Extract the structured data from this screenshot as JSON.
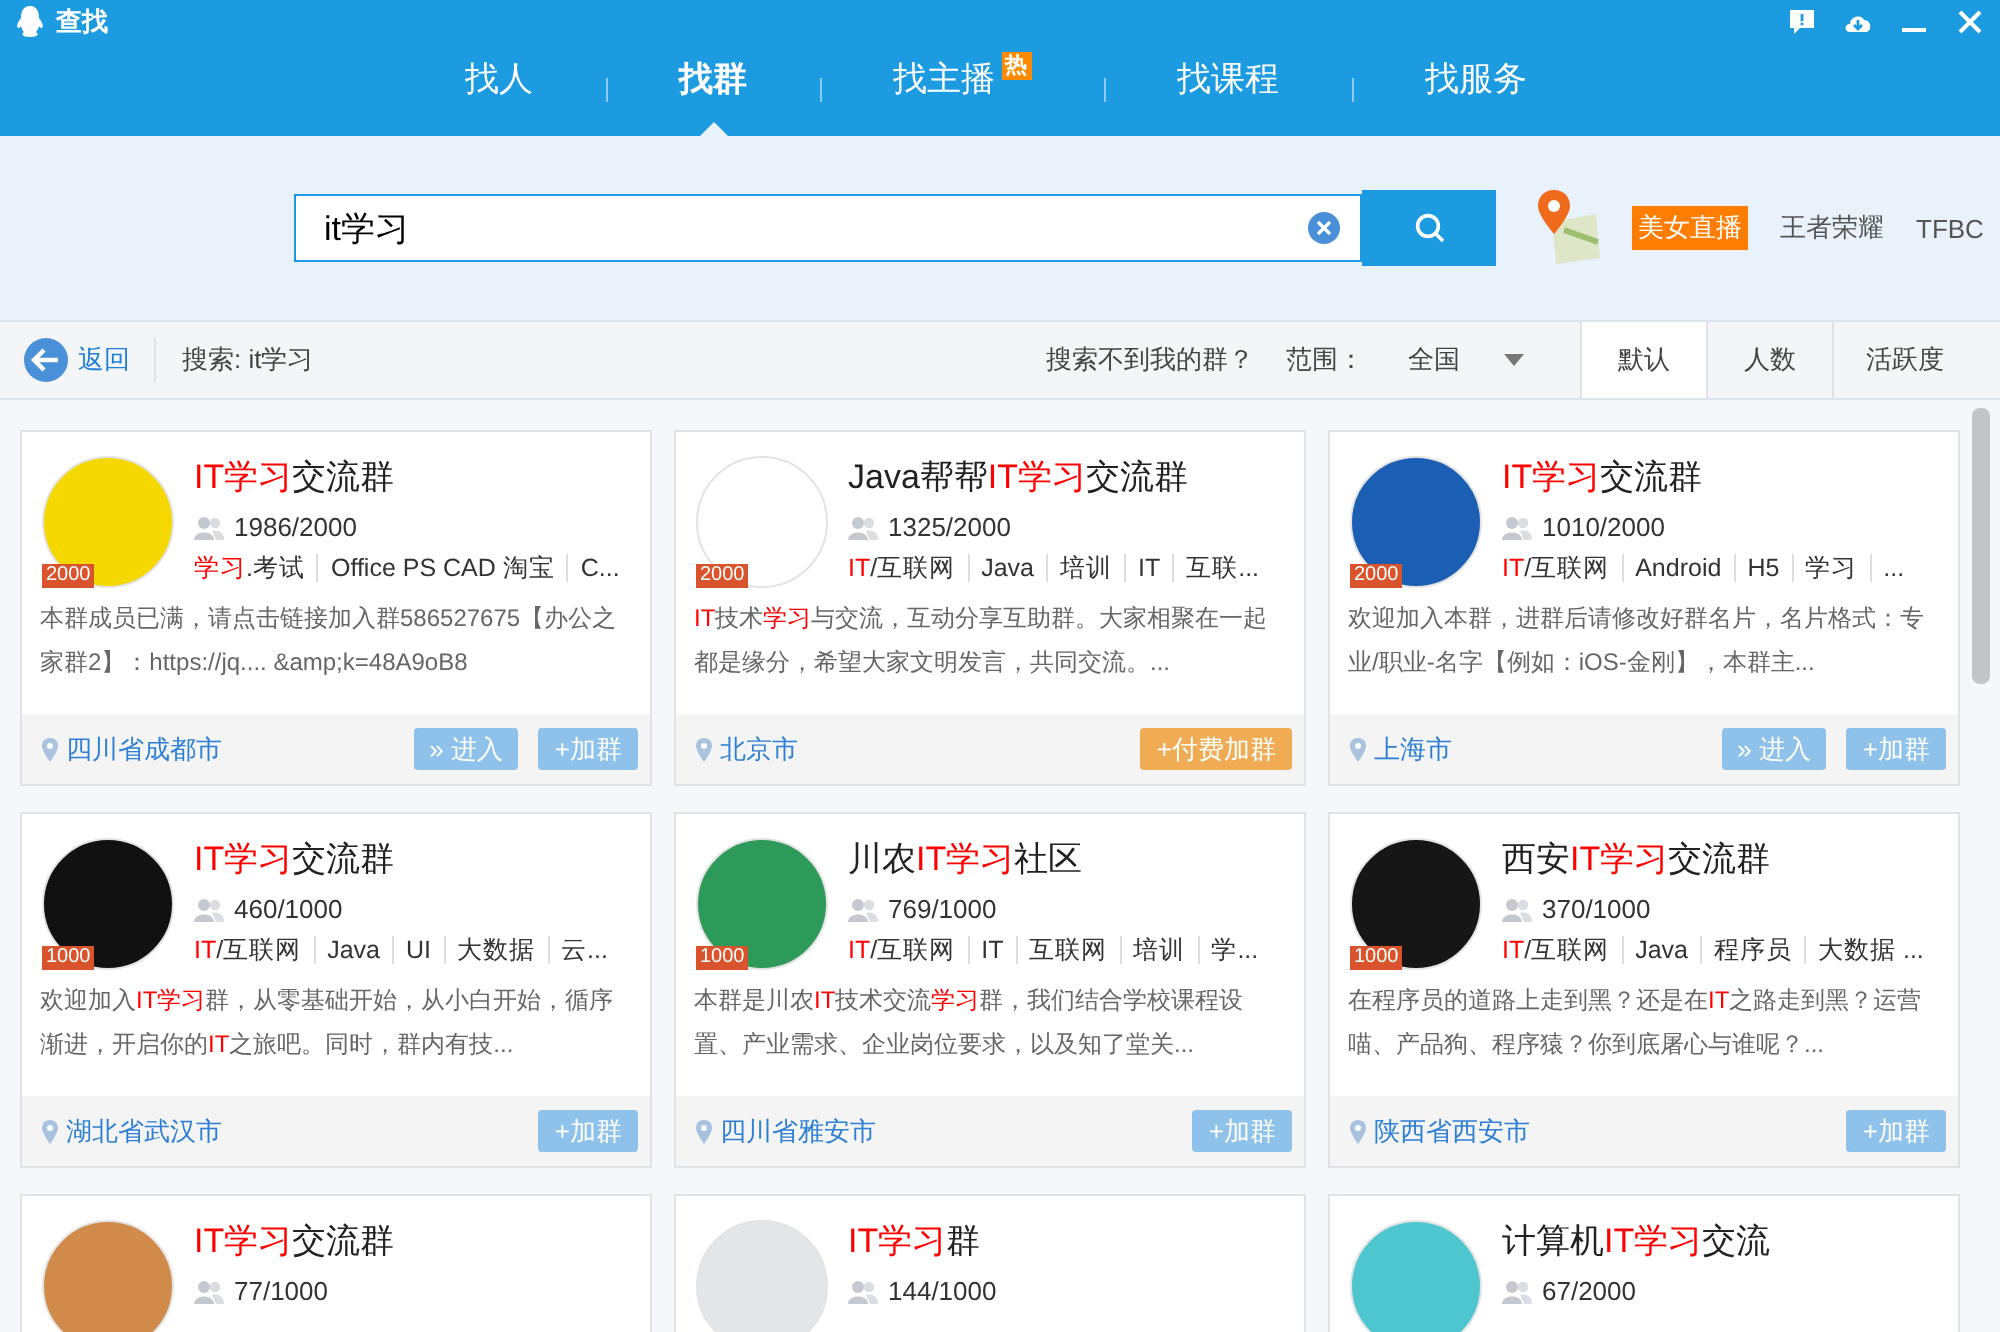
{
  "window": {
    "title": "查找"
  },
  "tabs": [
    {
      "label": "找人",
      "selected": false
    },
    {
      "label": "找群",
      "selected": true
    },
    {
      "label": "找主播",
      "selected": false,
      "badge": "热"
    },
    {
      "label": "找课程",
      "selected": false
    },
    {
      "label": "找服务",
      "selected": false
    }
  ],
  "search": {
    "value": "it学习"
  },
  "hot_links": [
    {
      "label": "美女直播",
      "kind": "tag"
    },
    {
      "label": "王者荣耀",
      "kind": "plain"
    },
    {
      "label": "TFBC",
      "kind": "plain"
    }
  ],
  "toolbar": {
    "back": "返回",
    "query": "搜索: it学习",
    "help": "搜索不到我的群？",
    "range_label": "范围：",
    "range_value": "全国",
    "sort_tabs": [
      {
        "label": "默认",
        "selected": true
      },
      {
        "label": "人数",
        "selected": false
      },
      {
        "label": "活跃度",
        "selected": false
      }
    ]
  },
  "groups": [
    {
      "color": "#f5d800",
      "cap": "2000",
      "title": [
        {
          "text": "IT学习",
          "match": true
        },
        {
          "text": "交流群",
          "match": false
        }
      ],
      "count": "1986/2000",
      "tags": [
        [
          {
            "text": "学习",
            "match": true
          },
          {
            "text": ".考试",
            "match": false
          }
        ],
        [
          {
            "text": "Office PS CAD 淘宝",
            "match": false
          }
        ],
        [
          {
            "text": "C...",
            "match": false
          }
        ]
      ],
      "desc": [
        {
          "text": "本群成员已满，请点击链接加入群586527675【办公之家群2】：https://jq.... &amp;k=48A9oB8",
          "match": false
        }
      ],
      "location": "四川省成都市",
      "buttons": [
        {
          "kind": "enter",
          "label": "» 进入"
        },
        {
          "kind": "join",
          "label": "+加群"
        }
      ]
    },
    {
      "color": "#ffffff",
      "cap": "2000",
      "title": [
        {
          "text": "Java帮帮",
          "match": false
        },
        {
          "text": "IT学习",
          "match": true
        },
        {
          "text": "交流群",
          "match": false
        }
      ],
      "count": "1325/2000",
      "tags": [
        [
          {
            "text": "IT",
            "match": true
          },
          {
            "text": "/互联网",
            "match": false
          }
        ],
        [
          {
            "text": "Java",
            "match": false
          }
        ],
        [
          {
            "text": "培训",
            "match": false
          }
        ],
        [
          {
            "text": "IT",
            "match": false
          }
        ],
        [
          {
            "text": "互联...",
            "match": false
          }
        ]
      ],
      "desc": [
        {
          "text": "IT",
          "match": true
        },
        {
          "text": "技术",
          "match": false
        },
        {
          "text": "学习",
          "match": true
        },
        {
          "text": "与交流，互动分享互助群。大家相聚在一起都是缘分，希望大家文明发言，共同交流。...",
          "match": false
        }
      ],
      "location": "北京市",
      "buttons": [
        {
          "kind": "paid_join",
          "label": "+付费加群"
        }
      ]
    },
    {
      "color": "#1a5fb4",
      "cap": "2000",
      "title": [
        {
          "text": "IT学习",
          "match": true
        },
        {
          "text": "交流群",
          "match": false
        }
      ],
      "count": "1010/2000",
      "tags": [
        [
          {
            "text": "IT",
            "match": true
          },
          {
            "text": "/互联网",
            "match": false
          }
        ],
        [
          {
            "text": "Android",
            "match": false
          }
        ],
        [
          {
            "text": "H5",
            "match": false
          }
        ],
        [
          {
            "text": "学习",
            "match": false
          }
        ],
        [
          {
            "text": "...",
            "match": false
          }
        ]
      ],
      "desc": [
        {
          "text": "欢迎加入本群，进群后请修改好群名片，名片格式：专业/职业-名字【例如：iOS-金刚】，本群主...",
          "match": false
        }
      ],
      "location": "上海市",
      "buttons": [
        {
          "kind": "enter",
          "label": "» 进入"
        },
        {
          "kind": "join",
          "label": "+加群"
        }
      ]
    },
    {
      "color": "#111111",
      "cap": "1000",
      "title": [
        {
          "text": "IT学习",
          "match": true
        },
        {
          "text": "交流群",
          "match": false
        }
      ],
      "count": "460/1000",
      "tags": [
        [
          {
            "text": "IT",
            "match": true
          },
          {
            "text": "/互联网",
            "match": false
          }
        ],
        [
          {
            "text": "Java",
            "match": false
          }
        ],
        [
          {
            "text": "UI",
            "match": false
          }
        ],
        [
          {
            "text": "大数据",
            "match": false
          }
        ],
        [
          {
            "text": "云...",
            "match": false
          }
        ]
      ],
      "desc": [
        {
          "text": "欢迎加入",
          "match": false
        },
        {
          "text": "IT学习",
          "match": true
        },
        {
          "text": "群，从零基础开始，从小白开始，循序渐进，开启你的",
          "match": false
        },
        {
          "text": "IT",
          "match": true
        },
        {
          "text": "之旅吧。同时，群内有技...",
          "match": false
        }
      ],
      "location": "湖北省武汉市",
      "buttons": [
        {
          "kind": "join",
          "label": "+加群"
        }
      ]
    },
    {
      "color": "#2e9a5a",
      "cap": "1000",
      "title": [
        {
          "text": "川农",
          "match": false
        },
        {
          "text": "IT学习",
          "match": true
        },
        {
          "text": "社区",
          "match": false
        }
      ],
      "count": "769/1000",
      "tags": [
        [
          {
            "text": "IT",
            "match": true
          },
          {
            "text": "/互联网",
            "match": false
          }
        ],
        [
          {
            "text": "IT",
            "match": false
          }
        ],
        [
          {
            "text": "互联网",
            "match": false
          }
        ],
        [
          {
            "text": "培训",
            "match": false
          }
        ],
        [
          {
            "text": "学...",
            "match": false
          }
        ]
      ],
      "desc": [
        {
          "text": "本群是川农",
          "match": false
        },
        {
          "text": "IT",
          "match": true
        },
        {
          "text": "技术交流",
          "match": false
        },
        {
          "text": "学习",
          "match": true
        },
        {
          "text": "群，我们结合学校课程设置、产业需求、企业岗位要求，以及知了堂关...",
          "match": false
        }
      ],
      "location": "四川省雅安市",
      "buttons": [
        {
          "kind": "join",
          "label": "+加群"
        }
      ]
    },
    {
      "color": "#161616",
      "cap": "1000",
      "title": [
        {
          "text": "西安",
          "match": false
        },
        {
          "text": "IT学习",
          "match": true
        },
        {
          "text": "交流群",
          "match": false
        }
      ],
      "count": "370/1000",
      "tags": [
        [
          {
            "text": "IT",
            "match": true
          },
          {
            "text": "/互联网",
            "match": false
          }
        ],
        [
          {
            "text": "Java",
            "match": false
          }
        ],
        [
          {
            "text": "程序员",
            "match": false
          }
        ],
        [
          {
            "text": "大数据 ...",
            "match": false
          }
        ]
      ],
      "desc": [
        {
          "text": "在程序员的道路上走到黑？还是在",
          "match": false
        },
        {
          "text": "IT",
          "match": true
        },
        {
          "text": "之路走到黑？运营喵、产品狗、程序猿？你到底屠心与谁呢？...",
          "match": false
        }
      ],
      "location": "陕西省西安市",
      "buttons": [
        {
          "kind": "join",
          "label": "+加群"
        }
      ]
    },
    {
      "color": "#d08a4a",
      "title": [
        {
          "text": "IT学习",
          "match": true
        },
        {
          "text": "交流群",
          "match": false
        }
      ],
      "count": "77/1000"
    },
    {
      "color": "#e3e6e9",
      "title": [
        {
          "text": "IT学习",
          "match": true
        },
        {
          "text": "群",
          "match": false
        }
      ],
      "count": "144/1000"
    },
    {
      "color": "#4dc6d0",
      "title": [
        {
          "text": "计算机",
          "match": false
        },
        {
          "text": "IT学习",
          "match": true
        },
        {
          "text": "交流",
          "match": false
        }
      ],
      "count": "67/2000"
    }
  ]
}
